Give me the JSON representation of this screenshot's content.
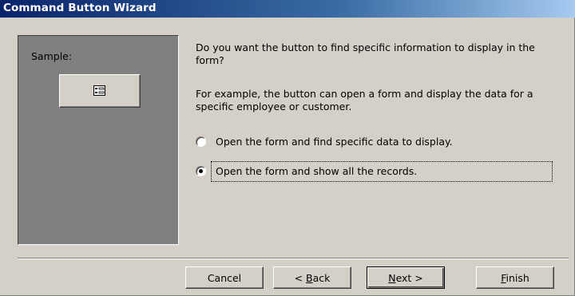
{
  "window": {
    "title": "Command Button Wizard"
  },
  "sample": {
    "label": "Sample:",
    "button_icon": "form-record-icon"
  },
  "main": {
    "prompt": "Do you want the button to find specific information to display in the form?",
    "example": "For example, the button can open a form and display the data for a specific employee or customer.",
    "options": [
      {
        "label": "Open the form and find specific data to display.",
        "selected": false
      },
      {
        "label": "Open the form and show all the records.",
        "selected": true
      }
    ]
  },
  "buttons": {
    "cancel": "Cancel",
    "back_prefix": "< ",
    "back_mnemonic": "B",
    "back_rest": "ack",
    "next_mnemonic": "N",
    "next_rest": "ext >",
    "finish_mnemonic": "F",
    "finish_rest": "inish"
  }
}
